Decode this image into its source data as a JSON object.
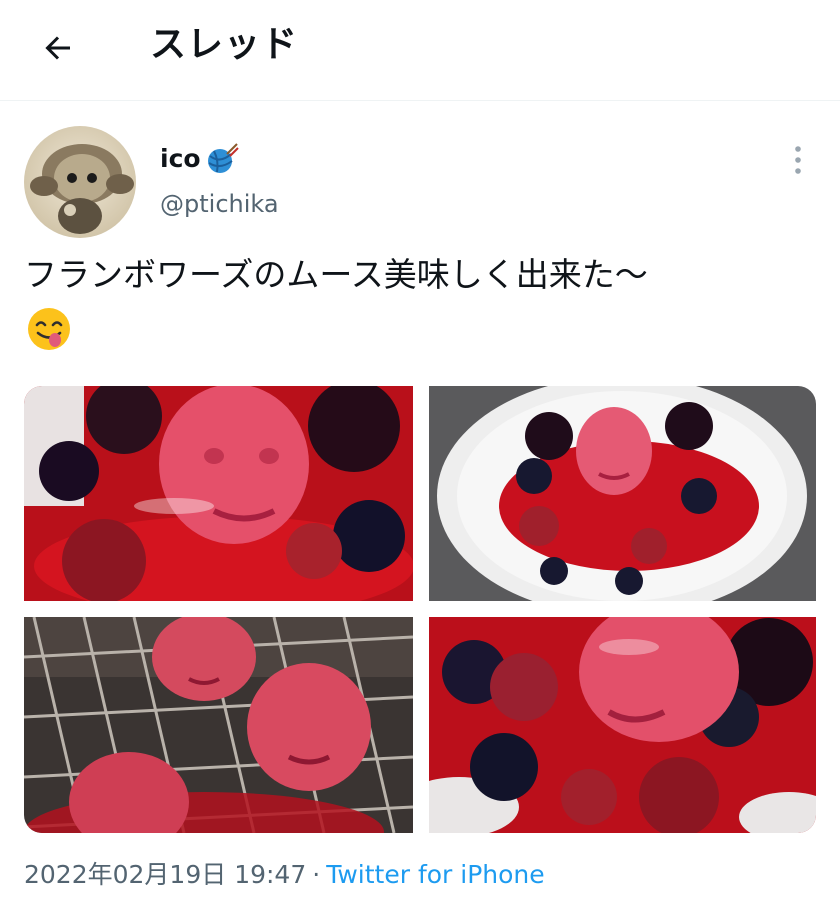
{
  "header": {
    "title": "スレッド",
    "back_icon": "arrow-left-icon"
  },
  "tweet": {
    "display_name": "ico",
    "name_emoji": "yarn-ball-icon",
    "handle": "@ptichika",
    "text": "フランボワーズのムース美味しく出来た〜",
    "text_emoji": "face-savoring-food-icon",
    "date": "2022年02月19日 19:47",
    "separator": "·",
    "source": "Twitter for iPhone",
    "photo_count": 4
  },
  "colors": {
    "text": "#0f1419",
    "secondary": "#536471",
    "link": "#1d9bf0",
    "divider": "#eff3f4"
  }
}
